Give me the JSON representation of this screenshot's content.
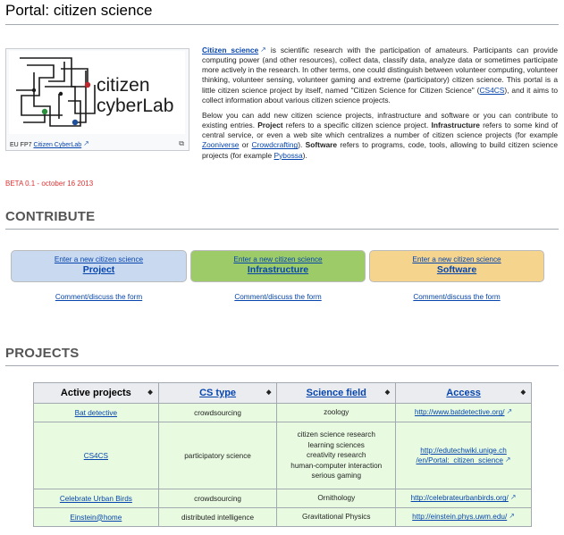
{
  "page": {
    "title": "Portal: citizen science"
  },
  "thumbnail": {
    "logo_text_line1": "citizen",
    "logo_text_line2": "cyberLab",
    "caption_prefix": "EU FP7",
    "caption_link": "Citizen CyberLab",
    "enlarge_icon": "enlarge-icon"
  },
  "beta": "BETA 0.1 - october 16 2013",
  "intro": {
    "p1": [
      {
        "t": "Citizen science",
        "link": true,
        "ext": true
      },
      {
        "t": " is scientific research with the participation of amateurs. Participants can provide computing power (and other resources), collect data, classify data, analyze data or sometimes participate more actively in the research. In other terms, one could distinguish between volunteer computing, volunteer thinking, volunteer sensing, volunteer gaming and extreme (participatory) citizen science. This portal is a little citizen science project by itself, named \"Citizen Science for Citizen Science\" ("
      },
      {
        "t": "CS4CS",
        "link": true
      },
      {
        "t": "), and it aims to collect information about various citizen science projects."
      }
    ],
    "p2": [
      {
        "t": "Below you can add new citizen science projects, infrastructure and software or you can contribute to existing entries. "
      },
      {
        "t": "Project",
        "bold": true
      },
      {
        "t": " refers to a specific citizen science project. "
      },
      {
        "t": "Infrastructure",
        "bold": true
      },
      {
        "t": " refers to some kind of central service, or even a web site which centralizes a number of citizen science projects (for example "
      },
      {
        "t": "Zooniverse",
        "link": true
      },
      {
        "t": " or "
      },
      {
        "t": "Crowdcrafting",
        "link": true
      },
      {
        "t": "). "
      },
      {
        "t": "Software",
        "bold": true
      },
      {
        "t": " refers to programs, code, tools, allowing to build citizen science projects (for example "
      },
      {
        "t": "Pybossa",
        "link": true
      },
      {
        "t": ")."
      }
    ]
  },
  "contribute": {
    "heading": "CONTRIBUTE",
    "boxes": [
      {
        "line1": "Enter a new citizen science",
        "line2": "Project",
        "bg": "#c9daf0",
        "comment": "Comment/discuss the form"
      },
      {
        "line1": "Enter a new citizen science",
        "line2": "Infrastructure",
        "bg": "#9ccb67",
        "comment": "Comment/discuss the form"
      },
      {
        "line1": "Enter a new citizen science",
        "line2": "Software",
        "bg": "#f5d48e",
        "comment": "Comment/discuss the form"
      }
    ]
  },
  "projects": {
    "heading": "PROJECTS",
    "columns": [
      "Active projects",
      "CS type",
      "Science field",
      "Access"
    ],
    "sort_icon": "sort-icon",
    "rows": [
      {
        "name": "Bat detective",
        "type": "crowdsourcing",
        "field": [
          "zoology"
        ],
        "access": [
          "http://www.batdetective.org/"
        ]
      },
      {
        "name": "CS4CS",
        "type": "participatory science",
        "field": [
          "citizen science research",
          "learning sciences",
          "creativity research",
          "human-computer interaction",
          "serious gaming"
        ],
        "access": [
          "http://edutechwiki.unige.ch",
          "/en/Portal:_citizen_science"
        ]
      },
      {
        "name": "Celebrate Urban Birds",
        "type": "crowdsourcing",
        "field": [
          "Ornithology"
        ],
        "access": [
          "http://celebrateurbanbirds.org/"
        ]
      },
      {
        "name": "Einstein@home",
        "type": "distributed intelligence",
        "field": [
          "Gravitational Physics"
        ],
        "access": [
          "http://einstein.phys.uwm.edu/"
        ]
      }
    ]
  },
  "colors": {
    "link": "#0645ad",
    "beta": "#dd3333",
    "row_bg": "#e8fbe1",
    "header_bg": "#eaecf0"
  }
}
